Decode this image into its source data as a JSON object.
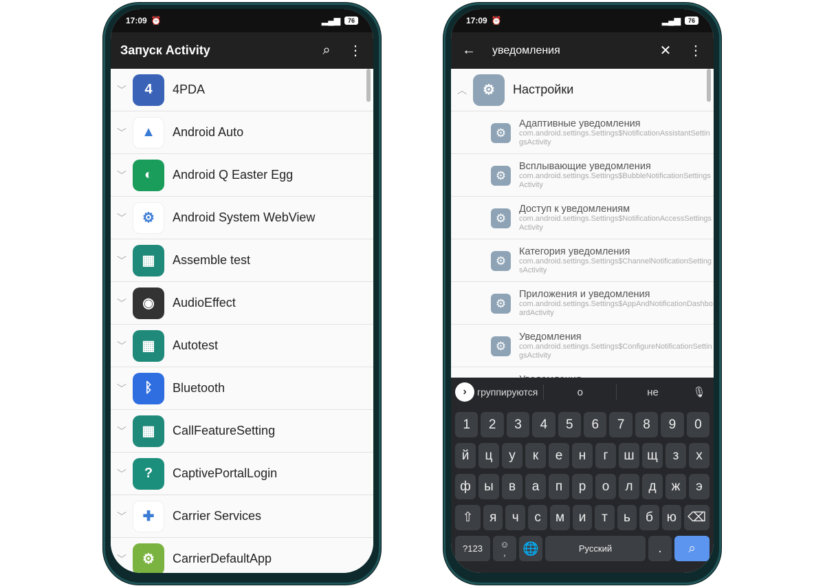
{
  "left": {
    "status": {
      "time": "17:09",
      "battery": "76"
    },
    "appbar": {
      "title": "Запуск Activity"
    },
    "apps": [
      {
        "label": "4PDA",
        "color": "#3a63b8",
        "glyph": "4"
      },
      {
        "label": "Android Auto",
        "color": "#ffffff",
        "glyph": "▲"
      },
      {
        "label": "Android Q Easter Egg",
        "color": "#1a9c5a",
        "glyph": "◐"
      },
      {
        "label": "Android System WebView",
        "color": "#ffffff",
        "glyph": "⚙"
      },
      {
        "label": "Assemble test",
        "color": "#1f8a7a",
        "glyph": "▦"
      },
      {
        "label": "AudioEffect",
        "color": "#333333",
        "glyph": "◉"
      },
      {
        "label": "Autotest",
        "color": "#1f8a7a",
        "glyph": "▦"
      },
      {
        "label": "Bluetooth",
        "color": "#2f6ee0",
        "glyph": "ᛒ"
      },
      {
        "label": "CallFeatureSetting",
        "color": "#1f8a7a",
        "glyph": "▦"
      },
      {
        "label": "CaptivePortalLogin",
        "color": "#1c8f7c",
        "glyph": "?"
      },
      {
        "label": "Carrier Services",
        "color": "#ffffff",
        "glyph": "✚"
      },
      {
        "label": "CarrierDefaultApp",
        "color": "#7bb341",
        "glyph": "⚙"
      }
    ]
  },
  "right": {
    "status": {
      "time": "17:09",
      "battery": "76"
    },
    "search": {
      "query": "уведомления"
    },
    "group": {
      "label": "Настройки"
    },
    "activities": [
      {
        "title": "Адаптивные уведомления",
        "pkg": "com.android.settings.Settings$NotificationAssistantSettingsActivity"
      },
      {
        "title": "Всплывающие уведомления",
        "pkg": "com.android.settings.Settings$BubbleNotificationSettingsActivity"
      },
      {
        "title": "Доступ к уведомлениям",
        "pkg": "com.android.settings.Settings$NotificationAccessSettingsActivity"
      },
      {
        "title": "Категория уведомления",
        "pkg": "com.android.settings.Settings$ChannelNotificationSettingsActivity"
      },
      {
        "title": "Приложения и уведомления",
        "pkg": "com.android.settings.Settings$AppAndNotificationDashboardActivity"
      },
      {
        "title": "Уведомления",
        "pkg": "com.android.settings.Settings$ConfigureNotificationSettingsActivity"
      },
      {
        "title": "Уведомления",
        "pkg": ""
      }
    ],
    "keyboard": {
      "suggestions": [
        "группируются",
        "о",
        "не"
      ],
      "rows": [
        [
          "1",
          "2",
          "3",
          "4",
          "5",
          "6",
          "7",
          "8",
          "9",
          "0"
        ],
        [
          "й",
          "ц",
          "у",
          "к",
          "е",
          "н",
          "г",
          "ш",
          "щ",
          "з",
          "х"
        ],
        [
          "ф",
          "ы",
          "в",
          "а",
          "п",
          "р",
          "о",
          "л",
          "д",
          "ж",
          "э"
        ],
        [
          "я",
          "ч",
          "с",
          "м",
          "и",
          "т",
          "ь",
          "б",
          "ю"
        ]
      ],
      "symbols_label": "?123",
      "comma": ",",
      "space_label": "Русский",
      "period": "."
    }
  }
}
